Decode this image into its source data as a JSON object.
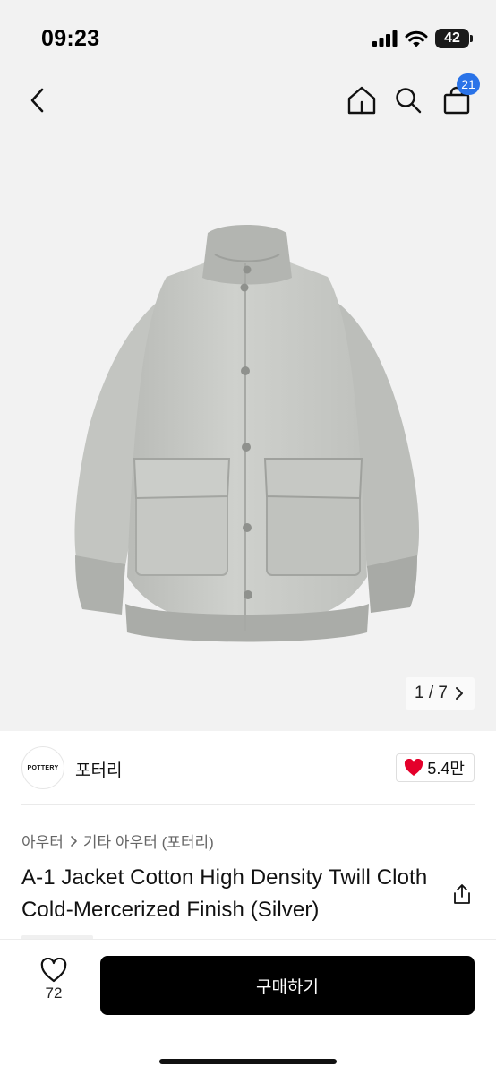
{
  "status_bar": {
    "time": "09:23",
    "battery": "42"
  },
  "nav": {
    "cart_count": "21"
  },
  "gallery": {
    "counter": "1 / 7"
  },
  "seller": {
    "logo_text": "POTTERY",
    "name": "포터리",
    "likes": "5.4만"
  },
  "breadcrumb": {
    "category": "아우터",
    "subcategory": "기타 아우터 (포터리)"
  },
  "product": {
    "title": "A-1 Jacket Cotton High Density Twill Cloth Cold-Mercerized Finish (Silver)"
  },
  "bottom_bar": {
    "wish_count": "72",
    "buy_label": "구매하기"
  },
  "icons": [
    "chevron-left-icon",
    "home-icon",
    "search-icon",
    "shopping-bag-icon",
    "chevron-right-icon",
    "heart-icon",
    "share-icon"
  ],
  "colors": {
    "accent_badge": "#2a73e8",
    "like_heart": "#e4002b",
    "buy_button": "#000000",
    "hero_background": "#f2f2f2"
  }
}
